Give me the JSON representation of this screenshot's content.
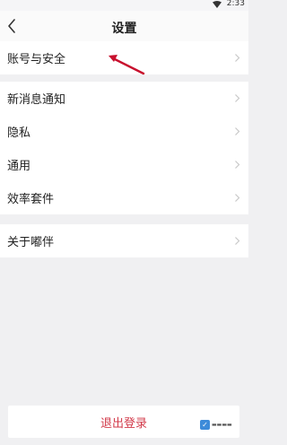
{
  "status_bar": {
    "time": "2:33"
  },
  "header": {
    "title": "设置"
  },
  "groups": [
    [
      {
        "label": "账号与安全"
      }
    ],
    [
      {
        "label": "新消息通知"
      },
      {
        "label": "隐私"
      },
      {
        "label": "通用"
      },
      {
        "label": "效率套件"
      }
    ],
    [
      {
        "label": "关于嘟伴"
      }
    ]
  ],
  "footer": {
    "logout_label": "退出登录"
  },
  "icons": {
    "back": "chevron-left-icon",
    "row": "chevron-right-icon",
    "wifi": "wifi-icon"
  },
  "colors": {
    "background": "#f0f0f2",
    "logout_text": "#d23a4a",
    "annotation_arrow": "#c8102e"
  }
}
